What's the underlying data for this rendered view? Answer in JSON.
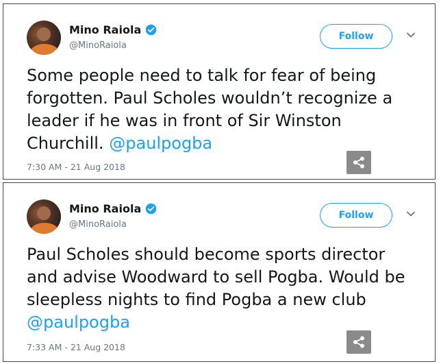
{
  "tweets": [
    {
      "author_name": "Mino Raiola",
      "handle": "@MinoRaiola",
      "follow_label": "Follow",
      "text": "Some people need to talk for fear of being forgotten. Paul Scholes wouldn’t recognize a leader if he was in front of Sir Winston Churchill.",
      "mention": "@paulpogba",
      "timestamp": "7:30 AM - 21 Aug 2018"
    },
    {
      "author_name": "Mino Raiola",
      "handle": "@MinoRaiola",
      "follow_label": "Follow",
      "text": "Paul Scholes should become sports director and advise Woodward to sell Pogba. Would be sleepless nights to find Pogba a new club",
      "mention": "@paulpogba",
      "timestamp": "7:33 AM - 21 Aug 2018"
    }
  ],
  "icons": {
    "verified": "verified-badge-icon",
    "menu": "chevron-down-icon",
    "share": "share-icon"
  },
  "colors": {
    "accent": "#1da1f2",
    "text": "#14171a",
    "secondary": "#657786",
    "share_bg": "#8a8a8a"
  }
}
